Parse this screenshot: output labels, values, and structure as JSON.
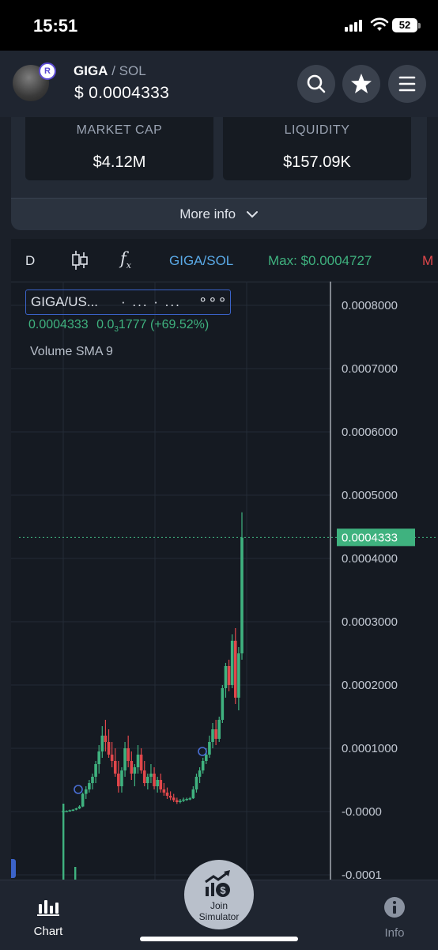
{
  "status_bar": {
    "time": "15:51",
    "battery": "52"
  },
  "header": {
    "token": "GIGA",
    "separator": "/",
    "quote": "SOL",
    "price": "$ 0.0004333",
    "avatar_badge": "R"
  },
  "stats": {
    "market_cap_label": "MARKET CAP",
    "market_cap_value": "$4.12M",
    "liquidity_label": "LIQUIDITY",
    "liquidity_value": "$157.09K",
    "more_info": "More info"
  },
  "chart_toolbar": {
    "interval": "D",
    "fx_label": "f",
    "fx_sub": "x",
    "pair": "GIGA/SOL",
    "max": "Max: $0.0004727",
    "next_cut": "M"
  },
  "chart_legend": {
    "symbol": "GIGA/US...",
    "dots": "· ... · ...",
    "options": "∘∘∘",
    "last": "0.0004333",
    "change_prefix": "0.0",
    "change_sub": "3",
    "change_suffix": "1777",
    "change_pct": "(+69.52%)",
    "volume_indicator": "Volume SMA 9"
  },
  "chart_data": {
    "type": "candlestick",
    "y_axis_ticks": [
      "0.0008000",
      "0.0007000",
      "0.0006000",
      "0.0005000",
      "0.0004000",
      "0.0003000",
      "0.0002000",
      "0.0001000",
      "-0.0000",
      "-0.0001"
    ],
    "ylim": [
      -0.0001,
      0.0008
    ],
    "last_price": 0.0004333,
    "last_price_label": "0.0004333",
    "max": 0.0004727,
    "grid": true,
    "colors": {
      "up": "#3fb27f",
      "down": "#e0474b",
      "price_line": "#3fb27f"
    },
    "candles": [
      [
        0.0,
        0.0,
        -2e-05,
        1e-06
      ],
      [
        1e-06,
        2e-06,
        0.0,
        1e-06
      ],
      [
        1e-06,
        3e-06,
        0.0,
        2e-06
      ],
      [
        2e-06,
        4e-06,
        1e-06,
        3e-06
      ],
      [
        3e-06,
        6e-06,
        2e-06,
        5e-06
      ],
      [
        5e-06,
        1e-05,
        4e-06,
        8e-06
      ],
      [
        8e-06,
        3e-05,
        7e-06,
        2.8e-05
      ],
      [
        2.8e-05,
        4e-05,
        2e-05,
        3.5e-05
      ],
      [
        3.5e-05,
        5e-05,
        3e-05,
        4.5e-05
      ],
      [
        4.5e-05,
        6e-05,
        3.5e-05,
        5.5e-05
      ],
      [
        5.5e-05,
        8e-05,
        4.5e-05,
        7.5e-05
      ],
      [
        7.5e-05,
        0.000105,
        6e-05,
        9.5e-05
      ],
      [
        9.5e-05,
        0.000135,
        8.5e-05,
        0.00012
      ],
      [
        0.00012,
        0.000145,
        9.5e-05,
        0.00011
      ],
      [
        0.00011,
        0.00013,
        8.5e-05,
        9e-05
      ],
      [
        9e-05,
        0.00011,
        7e-05,
        8e-05
      ],
      [
        8e-05,
        0.0001,
        5.5e-05,
        6e-05
      ],
      [
        6e-05,
        8e-05,
        3e-05,
        4e-05
      ],
      [
        4e-05,
        7e-05,
        3e-05,
        6.5e-05
      ],
      [
        6.5e-05,
        0.00011,
        5.5e-05,
        0.0001
      ],
      [
        0.0001,
        0.00012,
        7e-05,
        8e-05
      ],
      [
        8e-05,
        9.5e-05,
        5e-05,
        6e-05
      ],
      [
        6e-05,
        7.5e-05,
        4e-05,
        7e-05
      ],
      [
        7e-05,
        0.000105,
        6e-05,
        9e-05
      ],
      [
        9e-05,
        0.0001,
        6e-05,
        6.5e-05
      ],
      [
        6.5e-05,
        8e-05,
        4e-05,
        4.5e-05
      ],
      [
        4.5e-05,
        6e-05,
        3.5e-05,
        5.5e-05
      ],
      [
        5.5e-05,
        7.5e-05,
        4.5e-05,
        6e-05
      ],
      [
        6e-05,
        7e-05,
        3.5e-05,
        4e-05
      ],
      [
        4e-05,
        5.5e-05,
        3e-05,
        5e-05
      ],
      [
        5e-05,
        6e-05,
        3e-05,
        3.5e-05
      ],
      [
        3.5e-05,
        4.5e-05,
        2.5e-05,
        3e-05
      ],
      [
        3e-05,
        3.8e-05,
        2e-05,
        2.5e-05
      ],
      [
        2.5e-05,
        3.2e-05,
        1.8e-05,
        2.2e-05
      ],
      [
        2.2e-05,
        2.8e-05,
        1.5e-05,
        1.8e-05
      ],
      [
        1.8e-05,
        2.2e-05,
        1.2e-05,
        1.5e-05
      ],
      [
        1.5e-05,
        2e-05,
        1.3e-05,
        1.7e-05
      ],
      [
        1.7e-05,
        2.2e-05,
        1.5e-05,
        1.9e-05
      ],
      [
        1.9e-05,
        2.2e-05,
        1.7e-05,
        2e-05
      ],
      [
        2e-05,
        2.3e-05,
        1.8e-05,
        2.1e-05
      ],
      [
        2.1e-05,
        4e-05,
        2e-05,
        3.5e-05
      ],
      [
        3.5e-05,
        6e-05,
        3e-05,
        5.5e-05
      ],
      [
        5.5e-05,
        7e-05,
        4.5e-05,
        6.5e-05
      ],
      [
        6.5e-05,
        8.5e-05,
        6e-05,
        8e-05
      ],
      [
        8e-05,
        0.0001,
        7.5e-05,
        9e-05
      ],
      [
        9e-05,
        0.00012,
        8.5e-05,
        0.00011
      ],
      [
        0.00011,
        0.00014,
        0.0001,
        0.00013
      ],
      [
        0.00013,
        0.000145,
        0.000105,
        0.000115
      ],
      [
        0.000115,
        0.00015,
        0.00011,
        0.000145
      ],
      [
        0.000145,
        0.0002,
        0.00014,
        0.000195
      ],
      [
        0.000195,
        0.000235,
        0.00018,
        0.00023
      ],
      [
        0.00023,
        0.00024,
        0.00019,
        0.0002
      ],
      [
        0.0002,
        0.00028,
        0.000195,
        0.00027
      ],
      [
        0.00027,
        0.00029,
        0.00017,
        0.00018
      ],
      [
        0.00018,
        0.00026,
        0.00016,
        0.00025
      ],
      [
        0.00025,
        0.000473,
        0.00024,
        0.000433
      ]
    ]
  },
  "bottom_nav": {
    "chart_label": "Chart",
    "simulator_line1": "Join",
    "simulator_line2": "Simulator",
    "info_label": "Info"
  }
}
